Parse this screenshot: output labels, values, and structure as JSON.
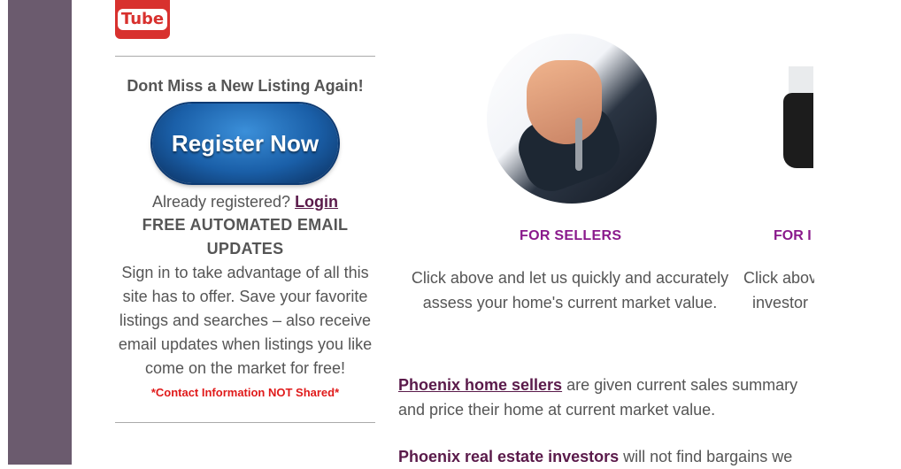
{
  "youtube": {
    "label": "Tube"
  },
  "sidebar": {
    "heading": "Dont Miss a New Listing Again!",
    "register_label": "Register Now",
    "already_text": "Already registered?",
    "login_label": "Login",
    "free_title": "FREE AUTOMATED EMAIL UPDATES",
    "signin_text": "Sign in to take advantage of all this site has to offer. Save your favorite listings and searches – also receive email updates when listings you like come on the market for free!",
    "contact_note": "*Contact Information NOT Shared*"
  },
  "cards": [
    {
      "title": "FOR SELLERS",
      "blurb_line1": "Click above and let us quickly and accurately",
      "blurb_line2": "assess your home's current market value."
    },
    {
      "title": "FOR I",
      "blurb_line1": "Click abov",
      "blurb_line2": "investor"
    }
  ],
  "body": {
    "p1_link": "Phoenix home sellers",
    "p1_rest": " are given current sales summary",
    "p1_line2": "and price their home at current market value.",
    "p2_bold": "Phoenix real estate investors",
    "p2_rest": " will not find bargains we"
  }
}
